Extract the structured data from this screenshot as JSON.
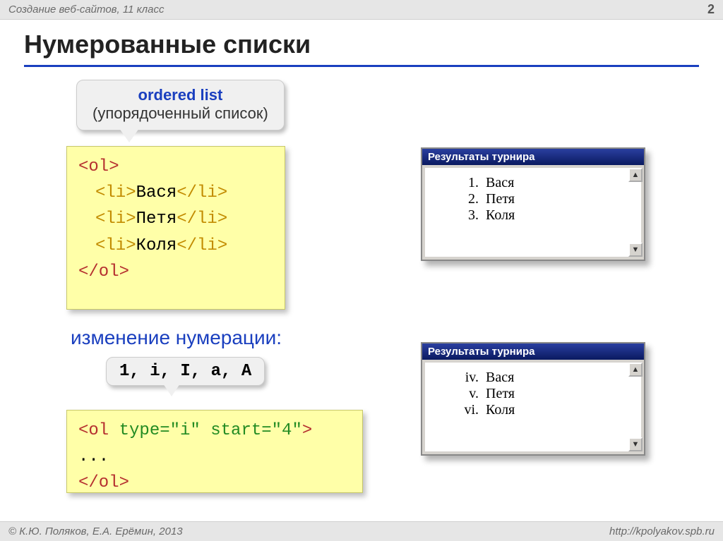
{
  "header": {
    "course": "Создание веб-сайтов, 11 класс",
    "page_number": "2"
  },
  "slide_title": "Нумерованные списки",
  "callout1": {
    "bold": "ordered list",
    "plain": "(упорядоченный список)"
  },
  "code1": {
    "open": "<ol>",
    "li_open": "<li>",
    "li_close": "</li>",
    "item1": "Вася",
    "item2": "Петя",
    "item3": "Коля",
    "close": "</ol>"
  },
  "sub_heading": "изменение нумерации:",
  "callout2": "1, i, I, a, A",
  "code2": {
    "open_lt": "<ol ",
    "attr1": "type=\"i\"",
    "attr2": "start=\"4\"",
    "gt": ">",
    "body": "...",
    "close": "</ol>"
  },
  "win1": {
    "title": "Результаты турнира",
    "rows": [
      {
        "num": "1.",
        "name": "Вася"
      },
      {
        "num": "2.",
        "name": "Петя"
      },
      {
        "num": "3.",
        "name": "Коля"
      }
    ]
  },
  "win2": {
    "title": "Результаты турнира",
    "rows": [
      {
        "num": "iv.",
        "name": "Вася"
      },
      {
        "num": "v.",
        "name": "Петя"
      },
      {
        "num": "vi.",
        "name": "Коля"
      }
    ]
  },
  "footer": {
    "copyright": "© К.Ю. Поляков, Е.А. Ерёмин, 2013",
    "url": "http://kpolyakov.spb.ru"
  }
}
